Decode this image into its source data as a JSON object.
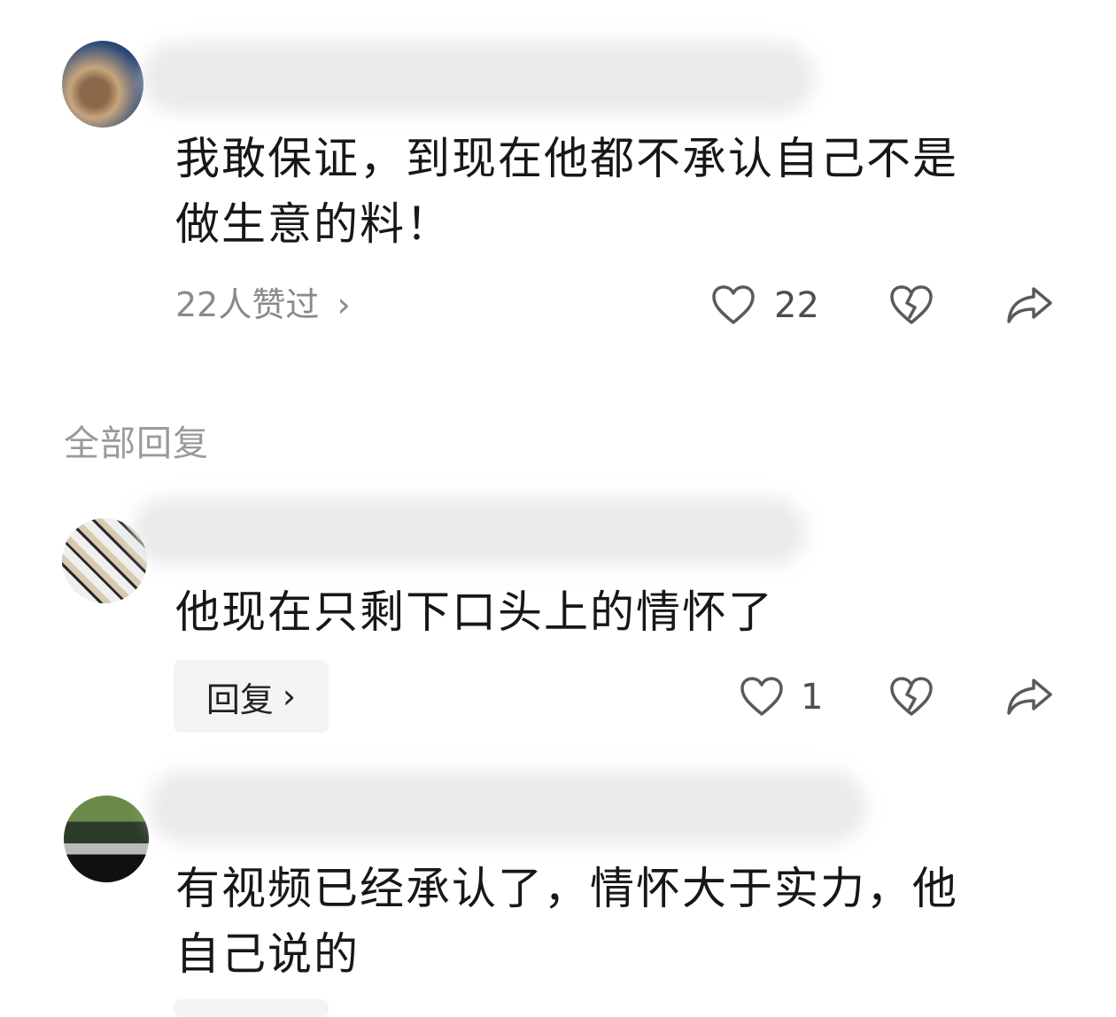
{
  "comments": [
    {
      "text_line1": "我敢保证，到现在他都不承认自己不是",
      "text_line2": "做生意的料！",
      "likes_summary": "22人赞过",
      "like_count": "22"
    },
    {
      "text_line1": "他现在只剩下口头上的情怀了",
      "reply_label": "回复",
      "like_count": "1"
    },
    {
      "text_line1": "有视频已经承认了，情怀大于实力，他",
      "text_line2": "自己说的"
    }
  ],
  "section_label": "全部回复",
  "chevron": "›",
  "icons": {
    "like": "heart-icon",
    "dislike": "broken-heart-icon",
    "share": "share-icon"
  },
  "colors": {
    "text": "#171717",
    "meta": "#8a8a8a",
    "icon": "#5a5a5a",
    "reply_bg": "#f4f4f4"
  }
}
